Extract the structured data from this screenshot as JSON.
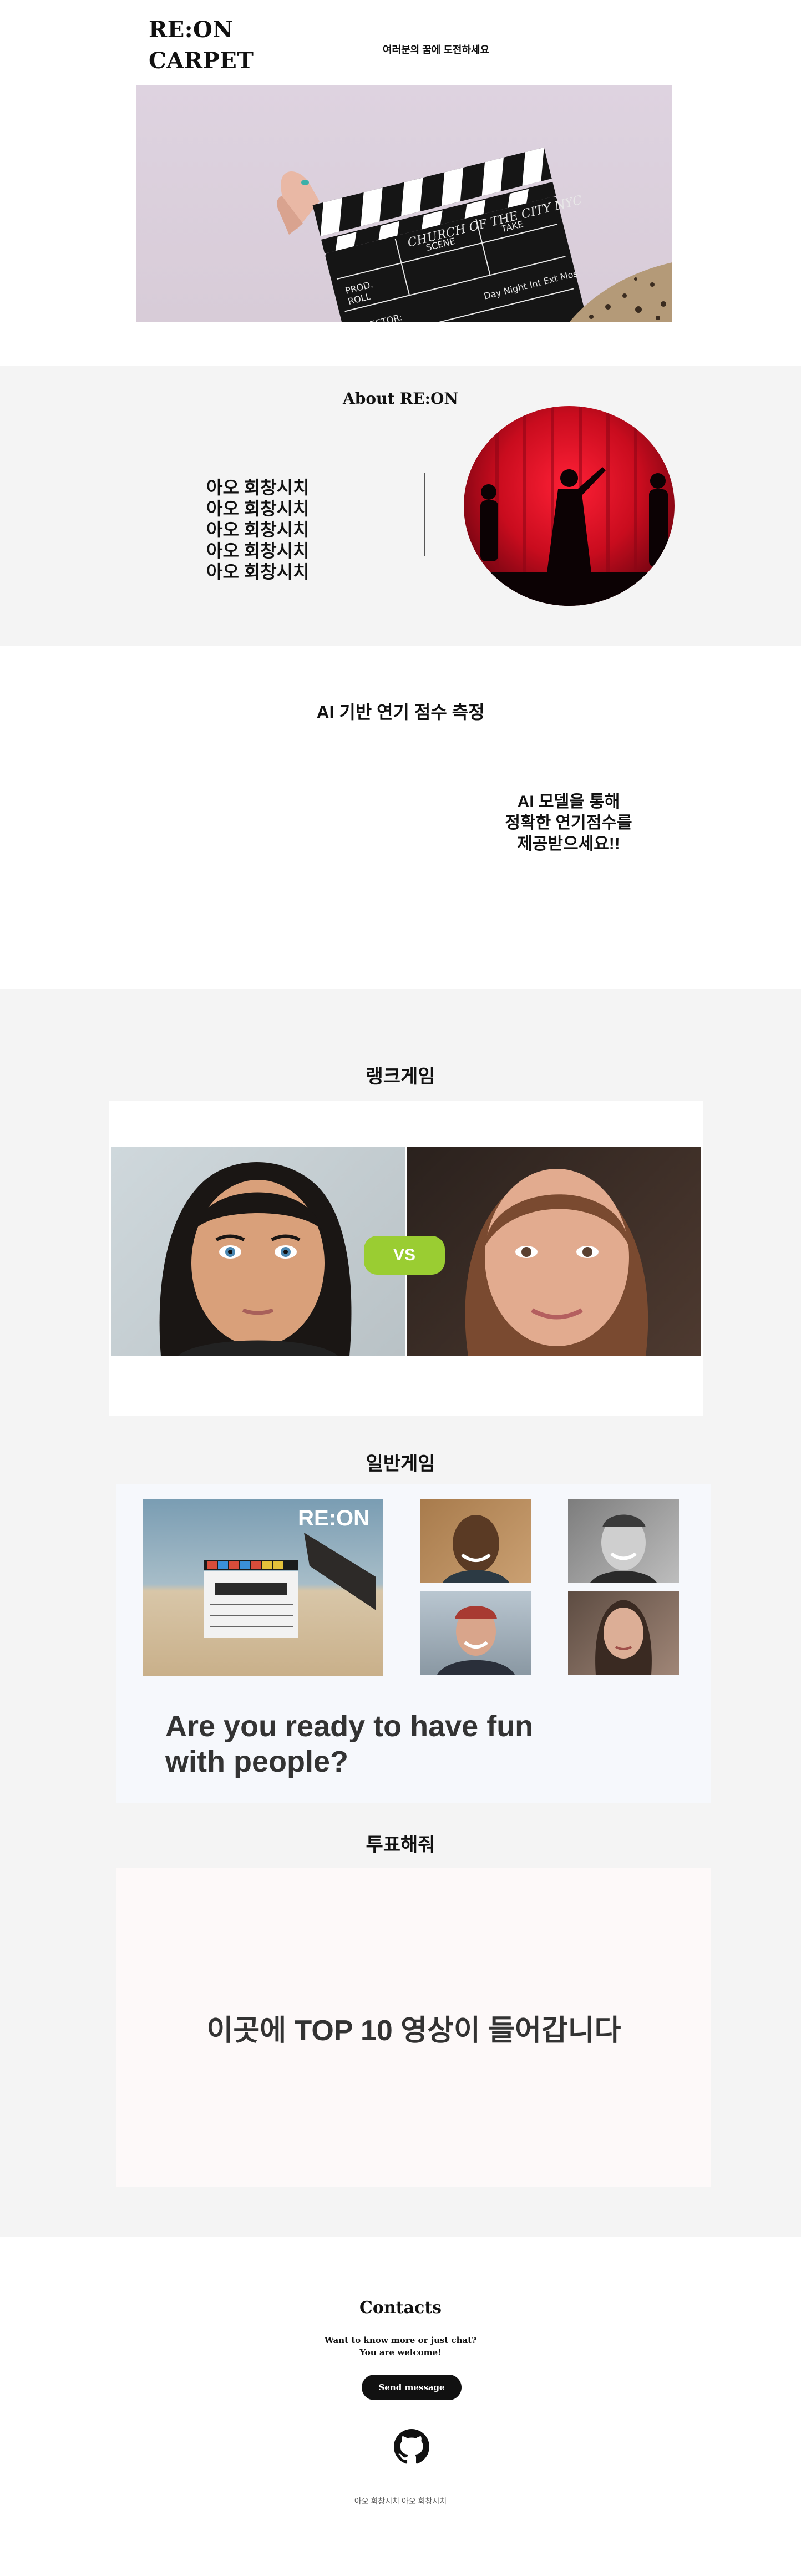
{
  "header": {
    "logo_line1": "RE:ON",
    "logo_line2": "CARPET",
    "tagline": "여러분의 꿈에 도전하세요"
  },
  "about": {
    "title": "About RE:ON",
    "lines": [
      "아오 회창시치",
      "아오 회창시치",
      "아오 회창시치",
      "아오 회창시치",
      "아오 회창시치"
    ]
  },
  "ai": {
    "title": "AI 기반 연기 점수 측정",
    "desc_line1": "AI 모델을 통해",
    "desc_line2": "정확한 연기점수를",
    "desc_line3": "제공받으세요!!"
  },
  "rank_game": {
    "title": "랭크게임",
    "vs_label": "VS"
  },
  "normal_game": {
    "title": "일반게임",
    "brand": "RE:ON",
    "headline_line1": "Are you ready to have fun",
    "headline_line2": "with people?"
  },
  "vote": {
    "title": "투표해줘",
    "placeholder_text": "이곳에 TOP 10 영상이 들어갑니다"
  },
  "contacts": {
    "title": "Contacts",
    "sub_line1": "Want to know more or just chat?",
    "sub_line2": "You are welcome!",
    "send_label": "Send message",
    "footer": "아오 회창시치 아오 회창시치"
  },
  "colors": {
    "accent_vs": "#9acd32",
    "section_bg": "#f4f4f4",
    "button_bg": "#111111"
  }
}
